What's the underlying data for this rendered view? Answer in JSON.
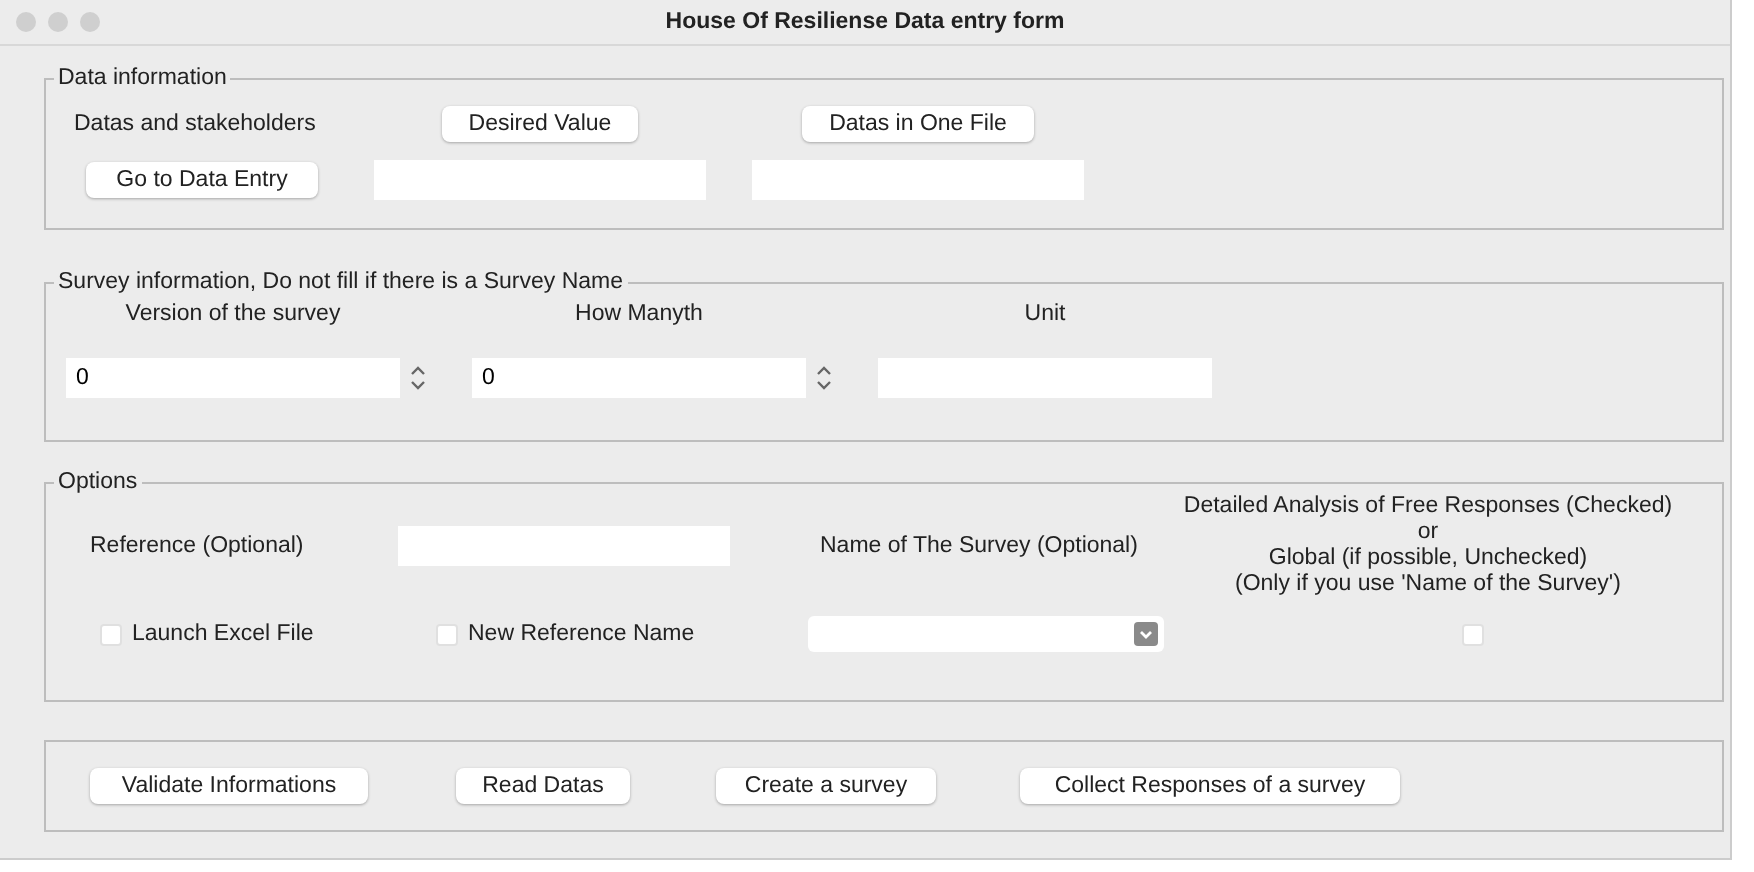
{
  "window": {
    "title": "House Of Resiliense Data entry form"
  },
  "data_information": {
    "legend": "Data information",
    "label": "Datas and stakeholders",
    "buttons": [
      "Desired Value",
      "Datas in One File"
    ],
    "entry_button": "Go to Data Entry",
    "fields": [
      {
        "kind": "text"
      },
      {
        "kind": "text"
      }
    ]
  },
  "survey_information": {
    "legend": "Survey information, Do not fill if there is a Survey Name",
    "fields": [
      {
        "label": "Version of the survey",
        "kind": "spinbox",
        "value": "0"
      },
      {
        "label": "How Manyth",
        "kind": "spinbox",
        "value": "0"
      },
      {
        "label": "Unit",
        "kind": "text"
      }
    ]
  },
  "options": {
    "legend": "Options",
    "reference_label": "Reference (Optional)",
    "survey_name_label": "Name of The Survey (Optional)",
    "analysis_note": [
      "Detailed Analysis of Free Responses (Checked)",
      "or",
      "Global (if possible, Unchecked)",
      "(Only if you use 'Name of the Survey')"
    ],
    "checkboxes": [
      {
        "label": "Launch Excel File",
        "checked": false
      },
      {
        "label": "New Reference Name",
        "checked": false
      }
    ],
    "analysis_checkbox": {
      "checked": false
    }
  },
  "actions": [
    "Validate Informations",
    "Read Datas",
    "Create a survey",
    "Collect Responses of a survey"
  ]
}
